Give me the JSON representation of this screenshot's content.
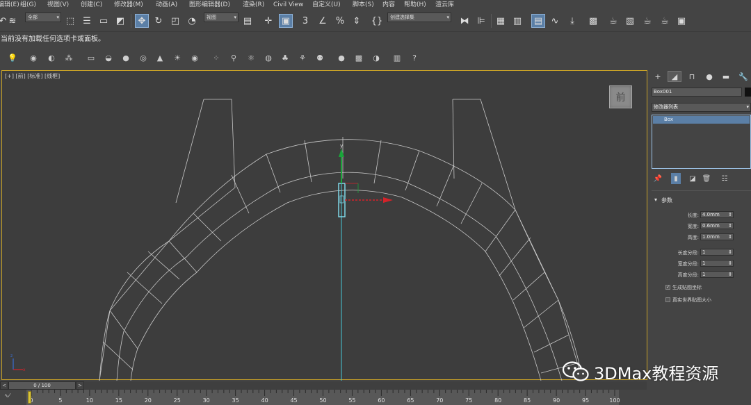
{
  "menubar": {
    "items": [
      "编辑(E)",
      "组(G)",
      "视图(V)",
      "创建(C)",
      "修改器(M)",
      "动画(A)",
      "图形编辑器(D)",
      "渲染(R)",
      "Civil View",
      "自定义(U)",
      "脚本(S)",
      "内容",
      "帮助(H)",
      "渲云库"
    ]
  },
  "toolbar": {
    "selection_filter": "全部",
    "reference_coord": "视图",
    "named_selection": "创建选择集"
  },
  "message_line": "当前没有加载任何选项卡或面板。",
  "viewport": {
    "label": "[+] [前] [标准] [线框]",
    "viewcube_label": "前",
    "gizmo_axis_y": "y",
    "mini_axes": "z x",
    "colors": {
      "border": "#c9a227",
      "wireframe": "#c8c8c8",
      "y_axis": "#1aa53a",
      "x_axis": "#d4232a",
      "selection": "#7fd8e8",
      "vertical_line": "#46c8d6"
    }
  },
  "command_panel": {
    "tabs": [
      "create",
      "modify",
      "hierarchy",
      "motion",
      "display",
      "utilities"
    ],
    "object_name": "Box001",
    "modifier_list": "修改器列表",
    "stack_item": "Box",
    "rollout_title": "参数",
    "params": [
      {
        "label": "长度:",
        "value": "4.0mm"
      },
      {
        "label": "宽度:",
        "value": "0.6mm"
      },
      {
        "label": "高度:",
        "value": "1.0mm"
      }
    ],
    "segments": [
      {
        "label": "长度分段:",
        "value": "1"
      },
      {
        "label": "宽度分段:",
        "value": "1"
      },
      {
        "label": "高度分段:",
        "value": "1"
      }
    ],
    "checkboxes": [
      {
        "label": "生成贴图坐标",
        "checked": true
      },
      {
        "label": "真实世界贴图大小",
        "checked": false
      }
    ]
  },
  "timeslider": {
    "position": "0 / 100",
    "left_arrow": "<",
    "right_arrow": ">"
  },
  "trackbar": {
    "ticks": [
      "0",
      "5",
      "10",
      "15",
      "20",
      "25",
      "30",
      "35",
      "40",
      "45",
      "50",
      "55",
      "60",
      "65",
      "70",
      "75",
      "80",
      "85",
      "90",
      "95",
      "100"
    ]
  },
  "watermark": {
    "text": "3DMax教程资源"
  }
}
